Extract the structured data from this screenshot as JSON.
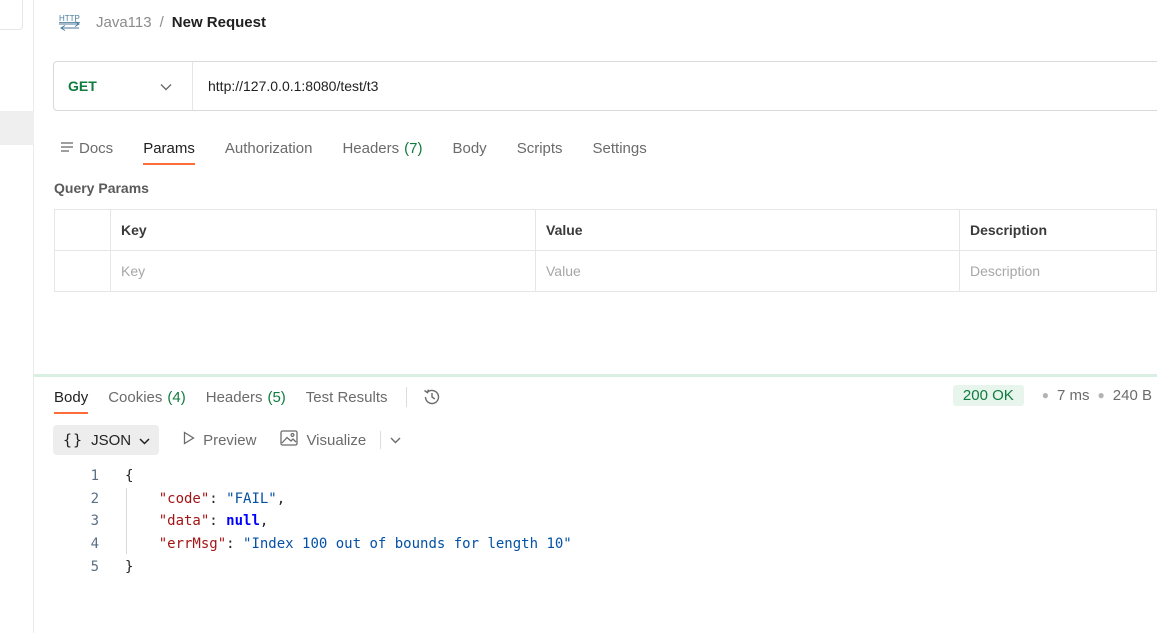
{
  "breadcrumb": {
    "icon": "http-icon",
    "parent": "Java113",
    "separator": "/",
    "current": "New Request"
  },
  "request": {
    "method": "GET",
    "url": "http://127.0.0.1:8080/test/t3"
  },
  "request_tabs": [
    {
      "label": "Docs",
      "icon": "docs-icon",
      "active": false
    },
    {
      "label": "Params",
      "active": true
    },
    {
      "label": "Authorization",
      "active": false
    },
    {
      "label": "Headers",
      "count": "(7)",
      "active": false
    },
    {
      "label": "Body",
      "active": false
    },
    {
      "label": "Scripts",
      "active": false
    },
    {
      "label": "Settings",
      "active": false
    }
  ],
  "query_params": {
    "title": "Query Params",
    "headers": {
      "key": "Key",
      "value": "Value",
      "description": "Description"
    },
    "placeholders": {
      "key": "Key",
      "value": "Value",
      "description": "Description"
    }
  },
  "response_tabs": [
    {
      "label": "Body",
      "active": true
    },
    {
      "label": "Cookies",
      "count": "(4)",
      "active": false
    },
    {
      "label": "Headers",
      "count": "(5)",
      "active": false
    },
    {
      "label": "Test Results",
      "active": false
    }
  ],
  "response_meta": {
    "status": "200 OK",
    "time": "7 ms",
    "size": "240 B"
  },
  "format_bar": {
    "format": "JSON",
    "braces": "{}",
    "preview": "Preview",
    "visualize": "Visualize"
  },
  "response_body": {
    "line_numbers": [
      "1",
      "2",
      "3",
      "4",
      "5"
    ],
    "open_brace": "{",
    "close_brace": "}",
    "fields": [
      {
        "key": "\"code\"",
        "value": "\"FAIL\"",
        "type": "string",
        "trailing": ","
      },
      {
        "key": "\"data\"",
        "value": "null",
        "type": "null",
        "trailing": ","
      },
      {
        "key": "\"errMsg\"",
        "value": "\"Index 100 out of bounds for length 10\"",
        "type": "string",
        "trailing": ""
      }
    ]
  },
  "colors": {
    "accent": "#ff6c37",
    "method_green": "#0f7b3e",
    "status_bg": "#e7f5ec"
  }
}
